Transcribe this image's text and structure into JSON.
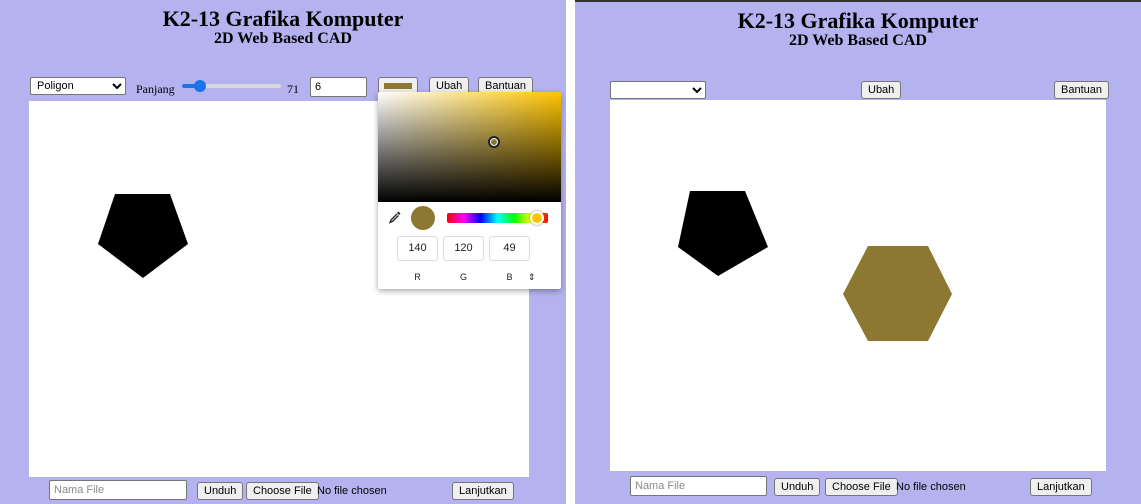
{
  "left": {
    "title": "K2-13 Grafika Komputer",
    "subtitle": "2D Web Based CAD",
    "toolbar": {
      "shape_select_value": "Poligon",
      "length_label": "Panjang",
      "length_value": "71",
      "length_fraction": 0.14,
      "sides_value": "6",
      "color_swatch": "#8c7831",
      "ubah_label": "Ubah",
      "bantuan_label": "Bantuan"
    },
    "color_picker": {
      "hue_color": "#ffc400",
      "selected_color": "#8c7831",
      "r": "140",
      "g": "120",
      "b": "49",
      "r_label": "R",
      "g_label": "G",
      "b_label": "B",
      "mode_toggle": "⇕",
      "hue_fraction": 0.89
    },
    "bottom": {
      "filename_placeholder": "Nama File",
      "unduh_label": "Unduh",
      "choose_file_label": "Choose File",
      "no_file_text": "No file chosen",
      "lanjutkan_label": "Lanjutkan"
    }
  },
  "right": {
    "title": "K2-13 Grafika Komputer",
    "subtitle": "2D Web Based CAD",
    "toolbar": {
      "shape_select_value": "",
      "ubah_label": "Ubah",
      "bantuan_label": "Bantuan"
    },
    "shapes": {
      "pentagon_color": "#000000",
      "hexagon_color": "#8c7831"
    },
    "bottom": {
      "filename_placeholder": "Nama File",
      "unduh_label": "Unduh",
      "choose_file_label": "Choose File",
      "no_file_text": "No file chosen",
      "lanjutkan_label": "Lanjutkan"
    }
  },
  "icons": {
    "select_arrow": "chevron-down-icon",
    "dropper": "eyedropper-icon",
    "picker_mode": "up-down-arrows-icon"
  }
}
